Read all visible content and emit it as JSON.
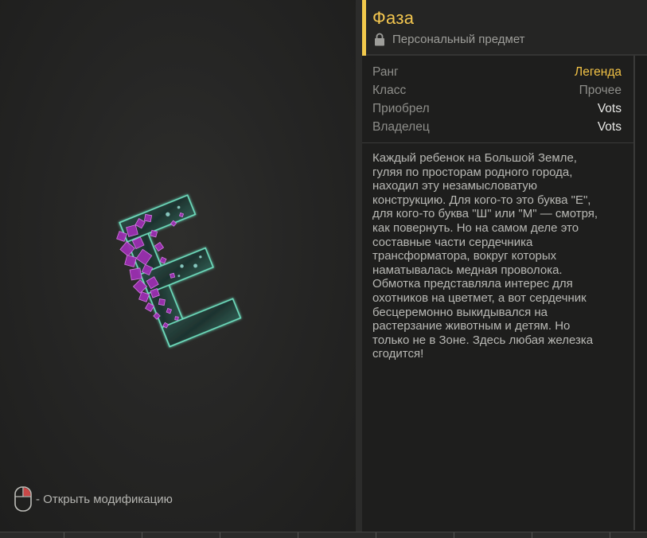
{
  "item": {
    "title": "Фаза",
    "subtitle": "Персональный предмет",
    "image_icon": "phase-letter-e-artifact-icon"
  },
  "stats": [
    {
      "label": "Ранг",
      "value": "Легенда"
    },
    {
      "label": "Класс",
      "value": "Прочее"
    },
    {
      "label": "Приобрел",
      "value": "Vots"
    },
    {
      "label": "Владелец",
      "value": "Vots"
    }
  ],
  "description": [
    "Каждый ребенок на Большой Земле,",
    "гуляя по просторам родного города,",
    "находил эту незамысловатую",
    "конструкцию. Для кого-то это буква \"Е\",",
    "для кого-то буква \"Ш\" или \"М\" — смотря,",
    "как повернуть. Но на самом деле это",
    "составные части сердечника",
    "трансформатора, вокруг которых",
    "наматывалась медная проволока.",
    "Обмотка представляла интерес для",
    "охотников на цветмет, а вот сердечник",
    "бесцеремонно выкидывался на",
    "растерзание животным и детям. Но",
    "только не в Зоне. Здесь любая железка",
    "сгодится!"
  ],
  "hint": {
    "icon": "mouse-right-click-icon",
    "text": "- Открыть модификацию"
  },
  "colors": {
    "title": "#f3c64f",
    "rank_legend": "#f2c246",
    "accent_bar": "#f2c94c",
    "crystal": "#c03fd0",
    "frame_glow": "#3fd0a0"
  }
}
